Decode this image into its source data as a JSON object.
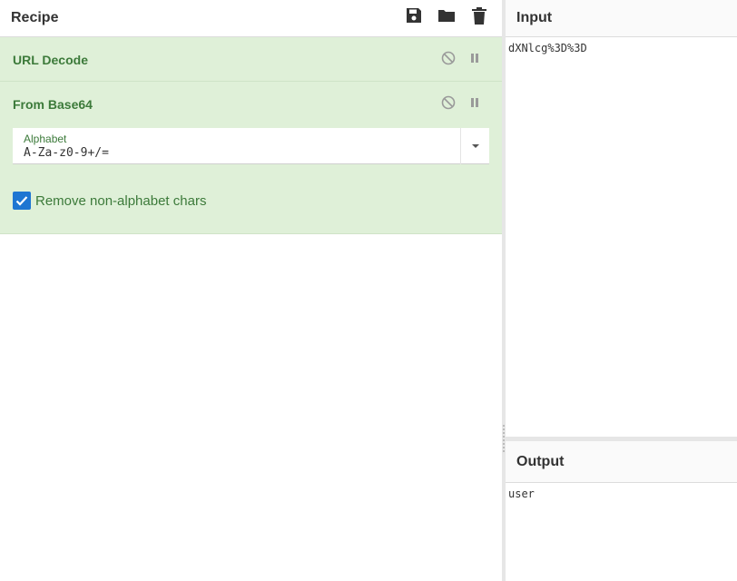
{
  "recipe": {
    "title": "Recipe",
    "icons": [
      "save-icon",
      "folder-icon",
      "trash-icon"
    ],
    "operations": [
      {
        "name": "URL Decode"
      },
      {
        "name": "From Base64",
        "alphabet_label": "Alphabet",
        "alphabet_value": "A-Za-z0-9+/=",
        "remove_label": "Remove non-alphabet chars",
        "remove_checked": true
      }
    ]
  },
  "input": {
    "title": "Input",
    "text": "dXNlcg%3D%3D"
  },
  "output": {
    "title": "Output",
    "text": "user"
  },
  "colors": {
    "op_bg": "#dff0d8",
    "op_text": "#3c7a3a",
    "checkbox": "#1e76d2"
  }
}
